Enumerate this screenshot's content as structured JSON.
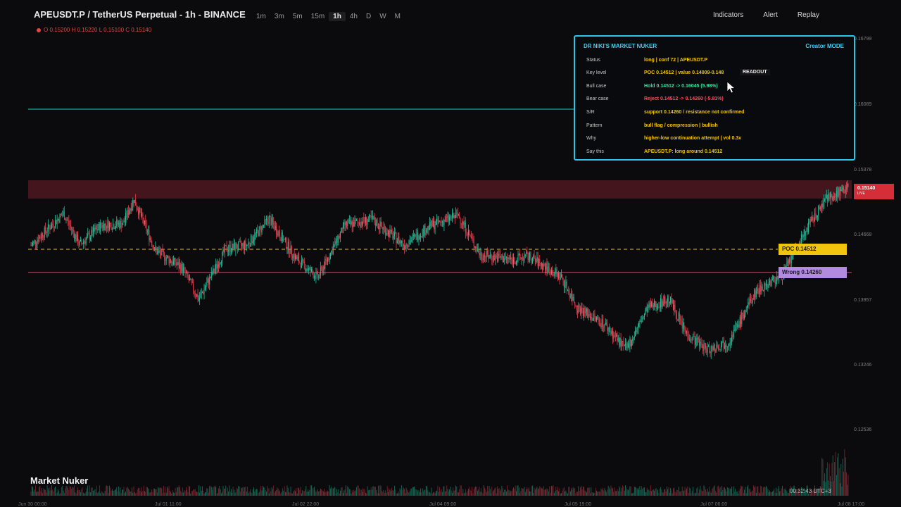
{
  "header": {
    "symbol": "APEUSDT.P / TetherUS Perpetual - 1h - BINANCE",
    "timeframes": [
      "1m",
      "3m",
      "5m",
      "15m",
      "1h",
      "4h",
      "D",
      "W",
      "M"
    ],
    "active_timeframe": "1h",
    "actions": [
      "Indicators",
      "Alert",
      "Replay"
    ],
    "ohlc": "O 0.15200 H 0.15220 L 0.15100 C 0.15140"
  },
  "price_axis": [
    "0.16799",
    "0.16089",
    "0.15378",
    "0.14668",
    "0.13957",
    "0.13246",
    "0.12536"
  ],
  "date_axis": [
    "Jun 30 00:00",
    "Jul 01 11:00",
    "Jul 02 22:00",
    "Jul 04 09:00",
    "Jul 05 19:00",
    "Jul 07 06:00",
    "Jul 08 17:00"
  ],
  "tags": {
    "last_price": "0.15140",
    "live": "LIVE",
    "poc": "POC 0.14512",
    "wrong": "Wrong 0.14260"
  },
  "panel": {
    "title": "DR NIKI'S MARKET NUKER",
    "mode": "Creator MODE",
    "readout": "READOUT",
    "rows": [
      {
        "key": "Status",
        "value": "long | conf 72 | APEUSDT.P",
        "color": "#f1c40f"
      },
      {
        "key": "Key level",
        "value": "POC 0.14512 | value 0.14009-0.148",
        "color": "#f1c40f"
      },
      {
        "key": "Bull case",
        "value": "Hold 0.14512 -> 0.16045 (5.98%)",
        "color": "#2ee59d"
      },
      {
        "key": "Bear case",
        "value": "Reject 0.14512 -> 0.14260 (-5.81%)",
        "color": "#ff4d5a"
      },
      {
        "key": "S/R",
        "value": "support 0.14260 / resistance not confirmed",
        "color": "#f1c40f"
      },
      {
        "key": "Pattern",
        "value": "bull flag / compression | bullish",
        "color": "#f1c40f"
      },
      {
        "key": "Why",
        "value": "higher-low continuation attempt | vol 0.3x",
        "color": "#f1c40f"
      },
      {
        "key": "Say this",
        "value": "APEUSDT.P: long around 0.14512",
        "color": "#f1c40f"
      }
    ]
  },
  "footer": {
    "brand": "Market Nuker",
    "clock": "00:32:43 UTC+3"
  },
  "chart_data": {
    "type": "candlestick",
    "ylim": [
      0.1225,
      0.169
    ],
    "levels": {
      "poc": 0.14512,
      "support": 0.1426,
      "resistance_zone": [
        0.151,
        0.1522
      ],
      "bull_target": 0.16045
    },
    "close_path": [
      [
        0,
        0.1444
      ],
      [
        6,
        0.1482
      ],
      [
        9,
        0.1445
      ],
      [
        13,
        0.1468
      ],
      [
        17,
        0.147
      ],
      [
        19,
        0.1499
      ],
      [
        23,
        0.1438
      ],
      [
        28,
        0.1417
      ],
      [
        31,
        0.138
      ],
      [
        36,
        0.144
      ],
      [
        40,
        0.1445
      ],
      [
        44,
        0.1476
      ],
      [
        49,
        0.1428
      ],
      [
        53,
        0.1406
      ],
      [
        58,
        0.1468
      ],
      [
        63,
        0.1475
      ],
      [
        69,
        0.1445
      ],
      [
        74,
        0.1468
      ],
      [
        79,
        0.148
      ],
      [
        83,
        0.1433
      ],
      [
        89,
        0.1427
      ],
      [
        92,
        0.1431
      ],
      [
        98,
        0.1406
      ],
      [
        101,
        0.137
      ],
      [
        106,
        0.135
      ],
      [
        110,
        0.132
      ],
      [
        114,
        0.137
      ],
      [
        118,
        0.138
      ],
      [
        121,
        0.134
      ],
      [
        125,
        0.132
      ],
      [
        129,
        0.133
      ],
      [
        134,
        0.139
      ],
      [
        139,
        0.141
      ],
      [
        143,
        0.146
      ],
      [
        147,
        0.15
      ],
      [
        151,
        0.1514
      ]
    ]
  }
}
